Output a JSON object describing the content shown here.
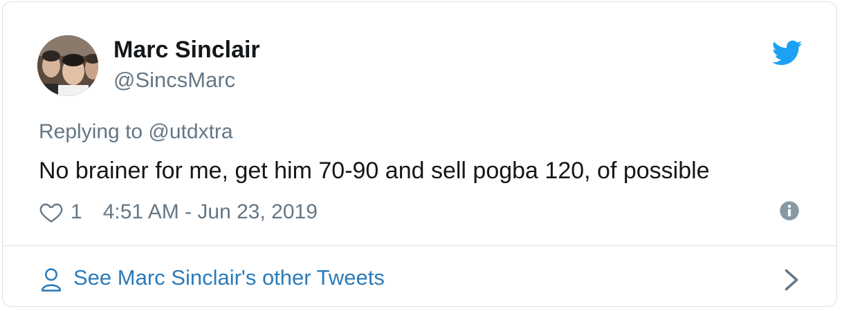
{
  "tweet": {
    "author": {
      "name": "Marc Sinclair",
      "handle": "@SincsMarc",
      "avatar_icon": "user-photo-avatar"
    },
    "reply_to": "Replying to @utdxtra",
    "text": "No brainer for me, get him 70-90 and sell pogba 120, of possible",
    "likes": "1",
    "timestamp": "4:51 AM - Jun 23, 2019",
    "icons": {
      "brand": "twitter-bird-icon",
      "like": "heart-icon",
      "info": "info-icon"
    }
  },
  "footer": {
    "link_label": "See Marc Sinclair's other Tweets",
    "icons": {
      "person": "person-icon",
      "chevron": "chevron-right-icon"
    }
  },
  "colors": {
    "brand_blue": "#1da1f2",
    "link_blue": "#2b7bb9",
    "secondary_text": "#657786",
    "primary_text": "#14171a",
    "border": "#d8e0e6"
  }
}
